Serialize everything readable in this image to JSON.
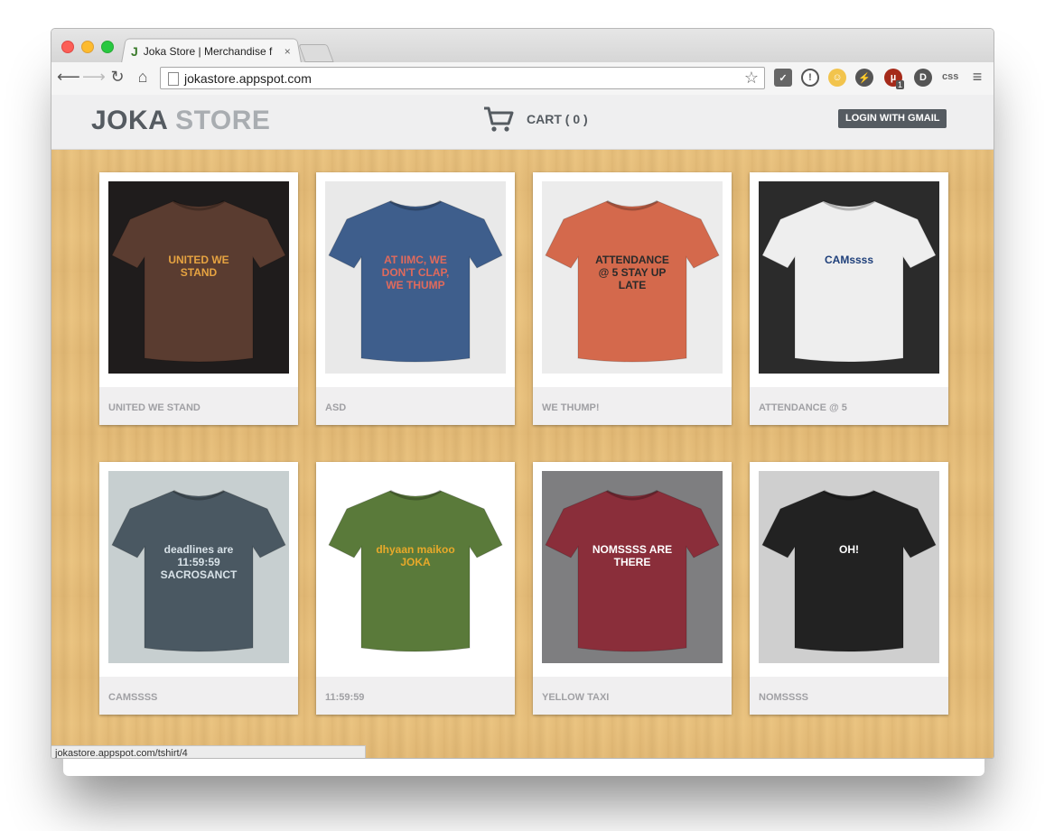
{
  "browser": {
    "tab_title": "Joka Store | Merchandise f",
    "tab_close": "×",
    "url": "jokastore.appspot.com",
    "status_url": "jokastore.appspot.com/tshirt/4",
    "ext_badge": "1",
    "ext_css_label": "css"
  },
  "header": {
    "logo_part1": "JOKA",
    "logo_part2": "STORE",
    "cart_label": "CART ( 0 )",
    "login_label": "LOGIN WITH GMAIL"
  },
  "products": [
    {
      "name": "UNITED WE STAND",
      "shirt_color": "#5a3c30",
      "bg_color": "#1f1c1c",
      "print_text": "UNITED WE STAND",
      "print_color": "#e6a341"
    },
    {
      "name": "ASD",
      "shirt_color": "#3e5e8c",
      "bg_color": "#e9e9e9",
      "print_text": "AT IIMC, WE DON'T CLAP, WE THUMP",
      "print_color": "#e06a5c"
    },
    {
      "name": "WE THUMP!",
      "shirt_color": "#d4694c",
      "bg_color": "#ececec",
      "print_text": "ATTENDANCE @ 5 STAY UP LATE",
      "print_color": "#2a2a2a"
    },
    {
      "name": "ATTENDANCE @ 5",
      "shirt_color": "#eeeeee",
      "bg_color": "#2b2b2b",
      "print_text": "CAMssss",
      "print_color": "#1e3f7a"
    },
    {
      "name": "CAMSSSS",
      "shirt_color": "#4a5862",
      "bg_color": "#c7cfd0",
      "print_text": "deadlines are 11:59:59 SACROSANCT",
      "print_color": "#d8e2e8"
    },
    {
      "name": "11:59:59",
      "shirt_color": "#5a7a3a",
      "bg_color": "#ffffff",
      "print_text": "dhyaan maikoo JOKA",
      "print_color": "#e8a92a"
    },
    {
      "name": "YELLOW TAXI",
      "shirt_color": "#8a2e3a",
      "bg_color": "#7e7e80",
      "print_text": "NOMSSSS ARE THERE",
      "print_color": "#ffffff"
    },
    {
      "name": "NOMSSSS",
      "shirt_color": "#222222",
      "bg_color": "#cfcfcf",
      "print_text": "OH!",
      "print_color": "#ffffff"
    }
  ]
}
